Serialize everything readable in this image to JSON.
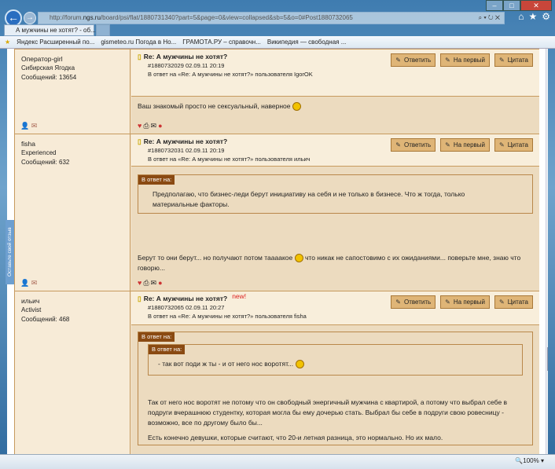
{
  "browser": {
    "url_prefix": "http://forum.",
    "url_host": "ngs.ru",
    "url_rest": "/board/psi/flat/1880731340?part=5&page=0&view=collapsed&sb=5&o=0#Post1880732065",
    "tab_title": "А мужчины не хотят? - об...",
    "favorites": [
      "Яндекс Расширенный по...",
      "gismeteo.ru Погода в Но...",
      "ГРАМОТА.РУ – справочн...",
      "Википедия — свободная ..."
    ],
    "zoom": "100%",
    "feedback_tab": "Оставьте свой отзыв"
  },
  "buttons": {
    "reply": "Ответить",
    "to_first": "На первый",
    "quote": "Цитата"
  },
  "quote_label": "В ответ на:",
  "posts": [
    {
      "user": "Оператор-girl",
      "rank": "Сибирская Ягодка",
      "count": "Сообщений: 13654",
      "title": "Re: А мужчины не хотят?",
      "id_date": "#1880732029 02.09.11 20:19",
      "reply_to": "В ответ на «Re: А мужчины не хотят?» пользователя IgorOK",
      "text": "Ваш знакомый просто не сексуальный, наверное"
    },
    {
      "user": "fisha",
      "rank": "Experienced",
      "count": "Сообщений: 632",
      "title": "Re: А мужчины не хотят?",
      "id_date": "#1880732031 02.09.11 20:19",
      "reply_to": "В ответ на «Re: А мужчины не хотят?» пользователя ильич",
      "quote": "Предполагаю, что бизнес-леди берут инициативу на себя и не только в бизнесе. Что ж тогда, только материальные факторы.",
      "text1": "Берут то они берут... но получают потом тааaакое",
      "text2": "что никак не сапостовимо с их ожиданиями... поверьте мне, знаю что говорю..."
    },
    {
      "user": "ильич",
      "rank": "Activist",
      "count": "Сообщений: 468",
      "title": "Re: А мужчины не хотят?",
      "new": "new!",
      "id_date": "#1880732065 02.09.11 20:27",
      "reply_to": "В ответ на «Re: А мужчины не хотят?» пользователя fisha",
      "inner_quote": "- так вот поди ж ты - и от него нос воротят...",
      "text1": "Так от него нос воротят не потому что он свободный энергичный мужчина с квартирой, а потому что выбрал себе в подруги вчерашнюю студентку, которая могла бы ему дочерью стать. Выбрал бы себе в подруги свою ровесницу - возможно, все по другому было бы...",
      "text2": "Есть конечно девушки, которые считают, что 20-и летная разница, это нормально. Но их мало."
    }
  ]
}
